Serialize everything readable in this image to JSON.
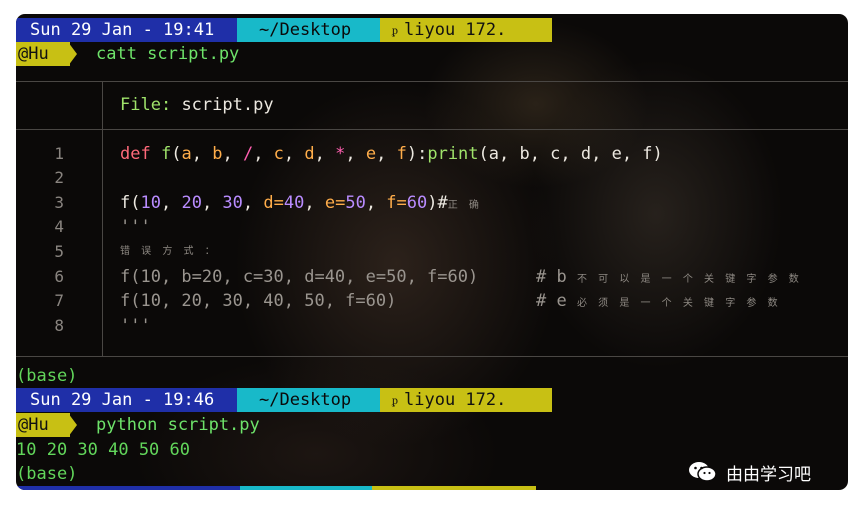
{
  "prompt1": {
    "date": "Sun 29 Jan - 19:41",
    "dir": "~/Desktop",
    "user": "liyou 172.",
    "host_label": "@Hu",
    "command": "catt script.py"
  },
  "file_header": {
    "label": "File:",
    "name": "script.py"
  },
  "code_lines": [
    {
      "num": "1"
    },
    {
      "num": "2"
    },
    {
      "num": "3"
    },
    {
      "num": "4"
    },
    {
      "num": "5"
    },
    {
      "num": "6"
    },
    {
      "num": "7"
    },
    {
      "num": "8"
    }
  ],
  "line1": {
    "def": "def",
    "name": "f",
    "a": "a",
    "b": "b",
    "slash": "/",
    "c": "c",
    "d": "d",
    "star": "*",
    "e": "e",
    "f": "f",
    "print": "print",
    "args": "(a, b, c, d, e, f)"
  },
  "line3": {
    "call": "f(",
    "n1": "10",
    "n2": "20",
    "n3": "30",
    "k1": "d=",
    "v1": "40",
    "k2": "e=",
    "v2": "50",
    "k3": "f=",
    "v3": "60",
    "close": ")#",
    "comment": "正 确"
  },
  "line4": "'''",
  "line5": "错 误 方 式 ：",
  "line6": {
    "code": "f(10, b=20, c=30, d=40, e=50, f=60)",
    "hash": "# b",
    "comment": "不 可 以 是 一 个 关 键 字 参 数"
  },
  "line7": {
    "code": "f(10, 20, 30, 40, 50, f=60)",
    "hash": "# e",
    "comment": "必 须 是 一 个 关 键 字 参 数"
  },
  "line8": "'''",
  "base1": "(base)",
  "prompt2": {
    "date": "Sun 29 Jan - 19:46",
    "dir": "~/Desktop",
    "user": "liyou 172.",
    "host_label": "@Hu",
    "command": "python script.py"
  },
  "output": "10 20 30 40 50 60",
  "base2": "(base)",
  "watermark": "由由学习吧",
  "colors": {
    "date_bg": "#1f2fa8",
    "dir_bg": "#18b9c9",
    "user_bg": "#c8c014",
    "prompt_text": "#6ee36a"
  }
}
